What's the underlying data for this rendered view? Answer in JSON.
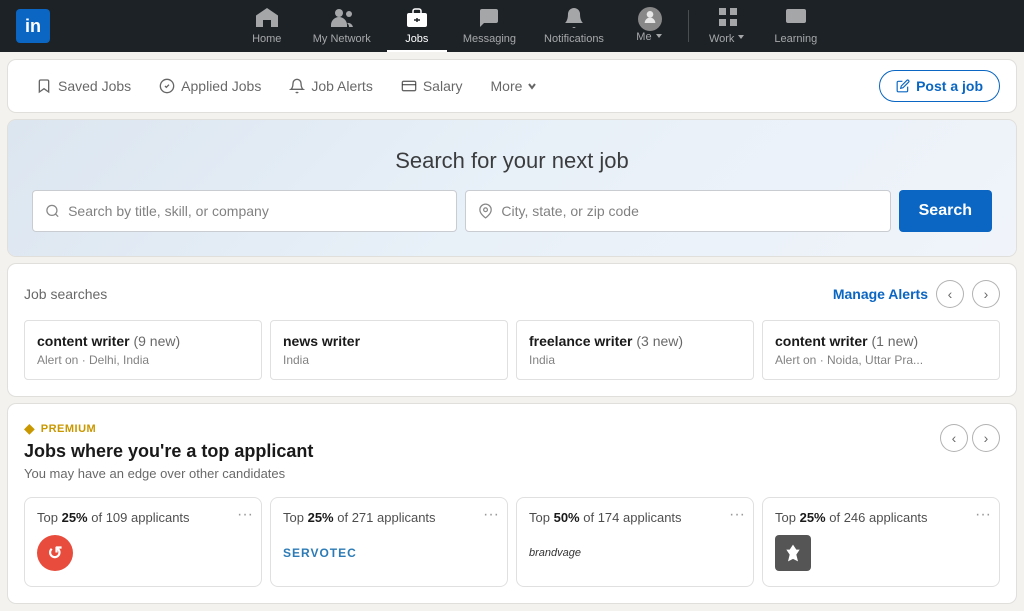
{
  "brand": {
    "name": "in",
    "logo_bg": "#0a66c2"
  },
  "navbar": {
    "items": [
      {
        "id": "home",
        "label": "Home",
        "icon": "home-icon",
        "active": false
      },
      {
        "id": "my-network",
        "label": "My Network",
        "icon": "network-icon",
        "active": false
      },
      {
        "id": "jobs",
        "label": "Jobs",
        "icon": "jobs-icon",
        "active": true
      },
      {
        "id": "messaging",
        "label": "Messaging",
        "icon": "messaging-icon",
        "active": false
      },
      {
        "id": "notifications",
        "label": "Notifications",
        "icon": "bell-icon",
        "active": false
      },
      {
        "id": "me",
        "label": "Me",
        "icon": "me-icon",
        "active": false,
        "has_dropdown": true
      },
      {
        "id": "work",
        "label": "Work",
        "icon": "grid-icon",
        "active": false,
        "has_dropdown": true
      },
      {
        "id": "learning",
        "label": "Learning",
        "icon": "learning-icon",
        "active": false
      }
    ]
  },
  "tabs": {
    "items": [
      {
        "id": "saved-jobs",
        "label": "Saved Jobs",
        "icon": "bookmark-icon"
      },
      {
        "id": "applied-jobs",
        "label": "Applied Jobs",
        "icon": "checkmark-icon"
      },
      {
        "id": "job-alerts",
        "label": "Job Alerts",
        "icon": "bell-small-icon"
      },
      {
        "id": "salary",
        "label": "Salary",
        "icon": "salary-icon"
      }
    ],
    "more_label": "More",
    "post_job_label": "Post a job"
  },
  "search_hero": {
    "title": "Search for your next job",
    "title_input_placeholder": "Search by title, skill, or company",
    "location_input_placeholder": "City, state, or zip code",
    "search_button_label": "Search"
  },
  "job_searches": {
    "section_title": "Job searches",
    "manage_alerts_label": "Manage Alerts",
    "cards": [
      {
        "title": "content writer",
        "badge": "(9 new)",
        "sub": "Alert on · Delhi, India"
      },
      {
        "title": "news writer",
        "badge": "",
        "sub": "India"
      },
      {
        "title": "freelance writer",
        "badge": "(3 new)",
        "sub": "India"
      },
      {
        "title": "content writer",
        "badge": "(1 new)",
        "sub": "Alert on · Noida, Uttar Pra..."
      }
    ]
  },
  "premium_section": {
    "badge_label": "PREMIUM",
    "heading": "Jobs where you're a top applicant",
    "sub": "You may have an edge over other candidates",
    "cards": [
      {
        "stat": "Top",
        "stat_pct": "25%",
        "stat_suffix": "of 109 applicants",
        "logo_type": "red-circle",
        "logo_text": "↺"
      },
      {
        "stat": "Top",
        "stat_pct": "25%",
        "stat_suffix": "of 271 applicants",
        "logo_type": "servotec",
        "logo_text": "SERVOTEC"
      },
      {
        "stat": "Top",
        "stat_pct": "50%",
        "stat_suffix": "of 174 applicants",
        "logo_type": "brandvage",
        "logo_text": "brandvage"
      },
      {
        "stat": "Top",
        "stat_pct": "25%",
        "stat_suffix": "of 246 applicants",
        "logo_type": "dark-icon",
        "logo_text": ""
      }
    ]
  }
}
